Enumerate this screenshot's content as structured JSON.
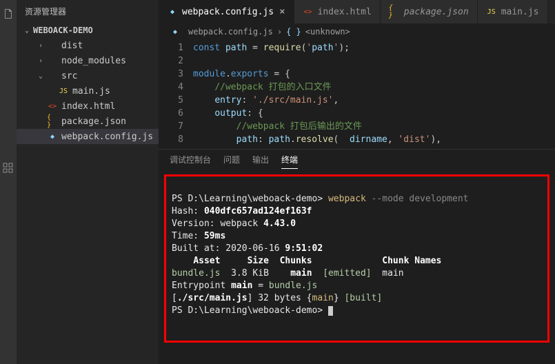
{
  "sidebar_title": "资源管理器",
  "folder_root": "WEBOACK-DEMO",
  "tree": [
    {
      "label": "dist",
      "type": "folder",
      "indent": 1,
      "open": false
    },
    {
      "label": "node_modules",
      "type": "folder",
      "indent": 1,
      "open": false
    },
    {
      "label": "src",
      "type": "folder",
      "indent": 1,
      "open": true
    },
    {
      "label": "main.js",
      "type": "js",
      "indent": 2
    },
    {
      "label": "index.html",
      "type": "html",
      "indent": 1
    },
    {
      "label": "package.json",
      "type": "json",
      "indent": 1
    },
    {
      "label": "webpack.config.js",
      "type": "webpack",
      "indent": 1,
      "active": true
    }
  ],
  "tabs": [
    {
      "label": "webpack.config.js",
      "type": "webpack",
      "active": true,
      "close": true
    },
    {
      "label": "index.html",
      "type": "html"
    },
    {
      "label": "package.json",
      "type": "json",
      "italic": true
    },
    {
      "label": "main.js",
      "type": "js"
    }
  ],
  "breadcrumb": {
    "file": "webpack.config.js",
    "symbol": "<unknown>"
  },
  "code": {
    "lines": [
      "const path = require('path');",
      "",
      "module.exports = {",
      "    //webpack 打包的入口文件",
      "    entry: './src/main.js',",
      "    output: {",
      "        //webpack 打包后输出的文件",
      "        path: path.resolve(  dirname, 'dist'),"
    ]
  },
  "panel_tabs": [
    "调试控制台",
    "问题",
    "输出",
    "终端"
  ],
  "panel_active": 3,
  "terminal": {
    "prompt": "PS D:\\Learning\\weboack-demo>",
    "cmd": "webpack",
    "cmd_args": "--mode development",
    "hash_label": "Hash:",
    "hash": "040dfc657ad124ef163f",
    "version": "Version: webpack",
    "version_num": "4.43.0",
    "time": "Time:",
    "time_val": "59ms",
    "built": "Built at: 2020-06-16",
    "built_time": "9:51:02",
    "hdr_asset": "Asset",
    "hdr_size": "Size",
    "hdr_chunks": "Chunks",
    "hdr_chunknames": "Chunk Names",
    "bundle": "bundle.js",
    "bundle_size": "3.8 KiB",
    "bundle_chunk": "main",
    "bundle_emitted": "[emitted]",
    "bundle_cname": "main",
    "entrypoint": "Entrypoint",
    "entrypoint_main": "main",
    "entrypoint_eq": "=",
    "entrypoint_bundle": "bundle.js",
    "src_file": "./src/main.js",
    "src_size": "32 bytes",
    "src_chunk": "main",
    "src_built": "[built]",
    "prompt2": "PS D:\\Learning\\weboack-demo>"
  }
}
